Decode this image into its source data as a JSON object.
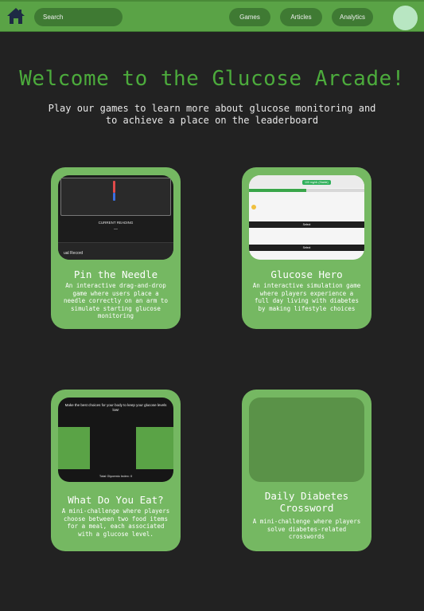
{
  "nav": {
    "search_placeholder": "Search",
    "links": [
      "Games",
      "Articles",
      "Analytics"
    ],
    "home_icon": "home-icon",
    "accent": "#5aa346"
  },
  "hero": {
    "title": "Welcome to the Glucose Arcade!",
    "subtitle": "Play our games to learn more about glucose monitoring and to achieve a place on the leaderboard"
  },
  "cards": [
    {
      "title": "Pin the Needle",
      "description": "An interactive drag-and-drop game where users place a needle correctly on an arm to simulate starting glucose monitoring",
      "thumb": {
        "reading": "CURRENT READING",
        "record": "ual Record"
      }
    },
    {
      "title": "Glucose Hero",
      "description": "An interactive simulation game where players experience a full day living with diabetes by making lifestyle choices",
      "thumb": {
        "chip": "100 mg/dL (Stable)",
        "select": "Select",
        "progress": 0.5
      }
    },
    {
      "title": "What Do You Eat?",
      "description": "A mini-challenge where players choose between two food items for a meal, each associated with a glucose level.",
      "thumb": {
        "prompt": "Make the best choices for your body to keep your glucose levels low!",
        "gi": "Total Glycemic Index: 0"
      }
    },
    {
      "title": "Daily Diabetes Crossword",
      "description": "A mini-challenge where players solve diabetes-related crosswords"
    }
  ]
}
